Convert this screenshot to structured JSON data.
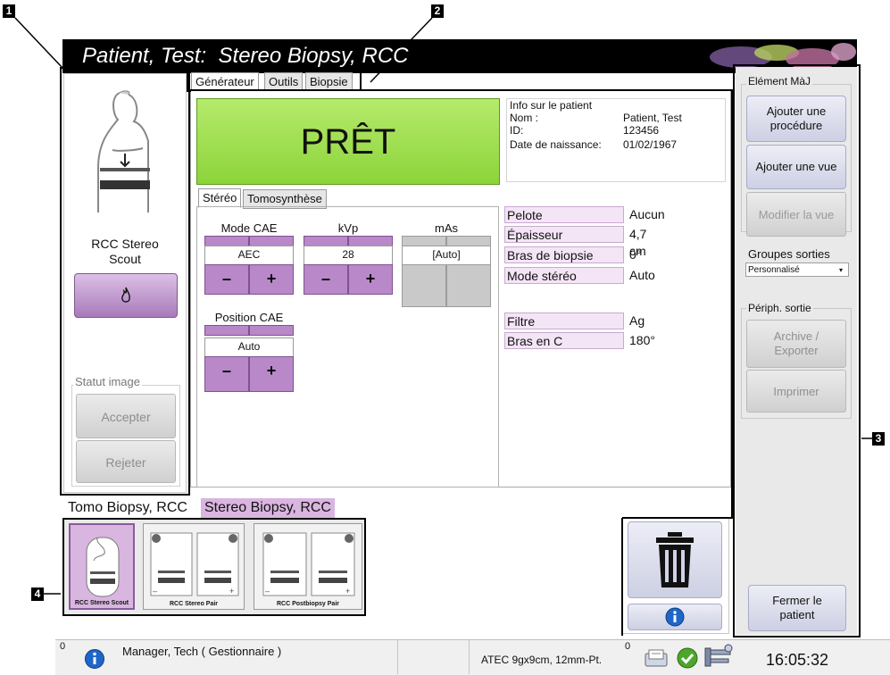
{
  "callouts": [
    "1",
    "2",
    "3",
    "4"
  ],
  "header": {
    "title": "Patient, Test:  Stereo Biopsy, RCC"
  },
  "left_panel": {
    "view_name_line1": "RCC Stereo",
    "view_name_line2": "Scout",
    "image_status_label": "Statut image",
    "accept_label": "Accepter",
    "reject_label": "Rejeter"
  },
  "main_tabs": [
    "Générateur",
    "Outils",
    "Biopsie"
  ],
  "ready_status": "PRÊT",
  "patient_info": {
    "heading": "Info sur le patient",
    "rows": [
      {
        "label": "Nom :",
        "value": "Patient, Test"
      },
      {
        "label": "ID:",
        "value": "123456"
      },
      {
        "label": "Date de naissance:",
        "value": "01/02/1967"
      }
    ]
  },
  "sub_tabs": [
    "Stéréo",
    "Tomosynthèse"
  ],
  "exposure": {
    "aec_mode": {
      "label": "Mode CAE",
      "value": "AEC"
    },
    "kvp": {
      "label": "kVp",
      "value": "28"
    },
    "mas": {
      "label": "mAs",
      "value": "[Auto]"
    },
    "aec_position": {
      "label": "Position CAE",
      "value": "Auto"
    },
    "minus": "–",
    "plus": "+"
  },
  "properties": [
    {
      "name": "Pelote",
      "value": "Aucun"
    },
    {
      "name": "Épaisseur",
      "value": "4,7 cm"
    },
    {
      "name": "Bras de biopsie",
      "value": "0°"
    },
    {
      "name": "Mode stéréo",
      "value": "Auto"
    },
    {
      "name": "Filtre",
      "value": "Ag"
    },
    {
      "name": "Bras en C",
      "value": "180°"
    }
  ],
  "right_panel": {
    "update_group_label": "Elément MàJ",
    "add_procedure": "Ajouter une procédure",
    "add_view": "Ajouter une vue",
    "edit_view": "Modifier la vue",
    "output_groups_label": "Groupes sorties",
    "output_group_selected": "Personnalisé",
    "output_devices_label": "Périph. sortie",
    "archive_export": "Archive / Exporter",
    "print": "Imprimer",
    "close_patient": "Fermer le patient"
  },
  "procedure_tabs": [
    "Tomo Biopsy, RCC",
    "Stereo Biopsy, RCC"
  ],
  "thumbnails": [
    "RCC Stereo Scout",
    "RCC Stereo Pair",
    "RCC Postbiopsy Pair"
  ],
  "status_bar": {
    "alarm_count": "0",
    "user": "Manager, Tech ( Gestionnaire )",
    "needle": "ATEC 9gx9cm, 12mm-Pt.",
    "queue_count": "0",
    "clock": "16:05:32"
  },
  "colors": {
    "ready_green": "#8cd43a",
    "purple": "#b888c8",
    "lavender": "#d6d8ea",
    "row_pink": "#f4e5f6"
  }
}
